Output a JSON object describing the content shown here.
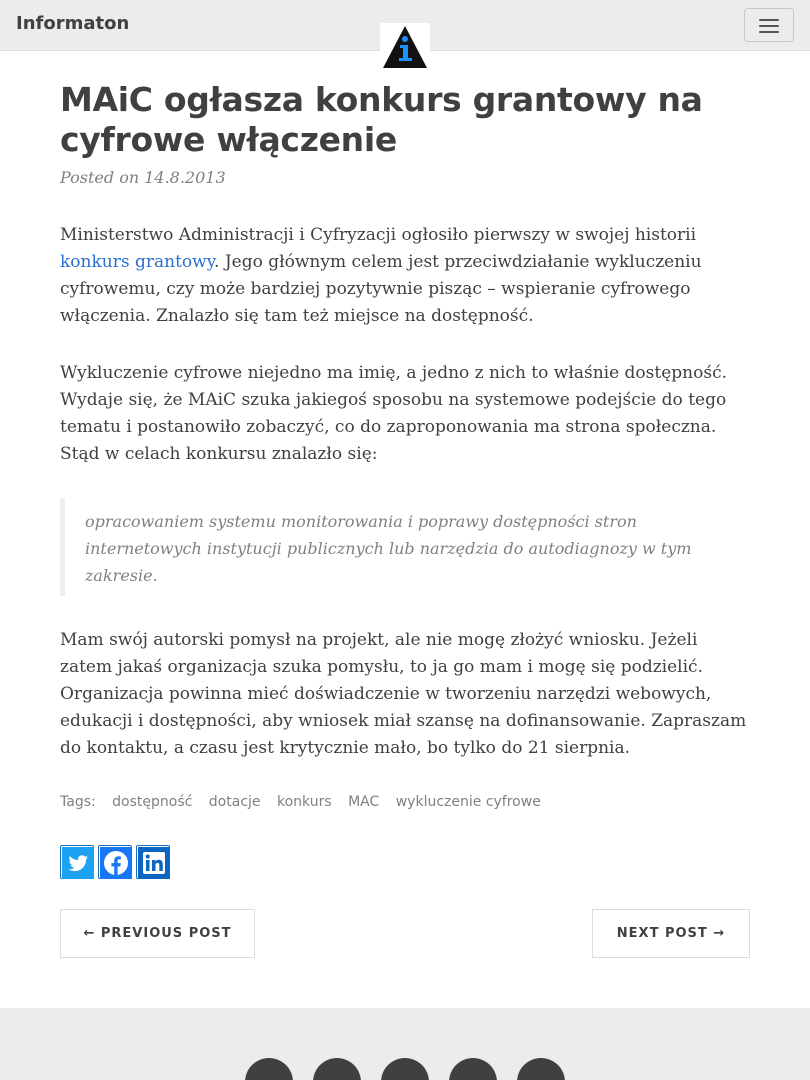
{
  "navbar": {
    "brand": "Informaton",
    "toggle_icon": "hamburger-menu-icon",
    "logo_icon": "info-triangle-logo-icon"
  },
  "post": {
    "title": "MAiC ogłasza konkurs grantowy na cyfrowe włączenie",
    "meta_prefix": "Posted on ",
    "date": "14.8.2013",
    "p1_before": "Ministerstwo Administracji i Cyfryzacji ogłosiło pierwszy w swojej historii ",
    "p1_link": "konkurs grantowy",
    "p1_after": ". Jego głównym celem jest przeciwdziałanie wykluczeniu cyfrowemu, czy może bardziej pozytywnie pisząc – wspieranie cyfrowego włączenia. Znalazło się tam też miejsce na dostępność.",
    "p2": "Wykluczenie cyfrowe niejedno ma imię, a jedno z nich to właśnie dostępność. Wydaje się, że MAiC szuka jakiegoś sposobu na systemowe podejście do tego tematu i postanowiło zobaczyć, co do zaproponowania ma strona społeczna. Stąd w celach konkursu znalazło się:",
    "quote": "opracowaniem systemu monitorowania i poprawy dostępności stron internetowych instytucji publicznych lub narzędzia do autodiagnozy w tym zakresie.",
    "p3": "Mam swój autorski pomysł na projekt, ale nie mogę złożyć wniosku. Jeżeli zatem jakaś organizacja szuka pomysłu, to ja go mam i mogę się podzielić. Organizacja powinna mieć doświadczenie w tworzeniu narzędzi webowych, edukacji i dostępności, aby wniosek miał szansę na dofinansowanie. Zapraszam do kontaktu, a czasu jest krytycznie mało, bo tylko do 21 sierpnia."
  },
  "tags": {
    "label": "Tags:",
    "items": [
      "dostępność",
      "dotacje",
      "konkurs",
      "MAC",
      "wykluczenie cyfrowe"
    ]
  },
  "share": {
    "icons": [
      "twitter-icon",
      "facebook-icon",
      "linkedin-icon"
    ],
    "brand_color": "#1a6fb0"
  },
  "pager": {
    "previous": "← PREVIOUS POST",
    "next": "NEXT POST →"
  },
  "footer": {
    "icons": [
      "rss-icon",
      "email-icon",
      "linkedin-icon",
      "phone-icon",
      "mastodon-icon"
    ]
  }
}
